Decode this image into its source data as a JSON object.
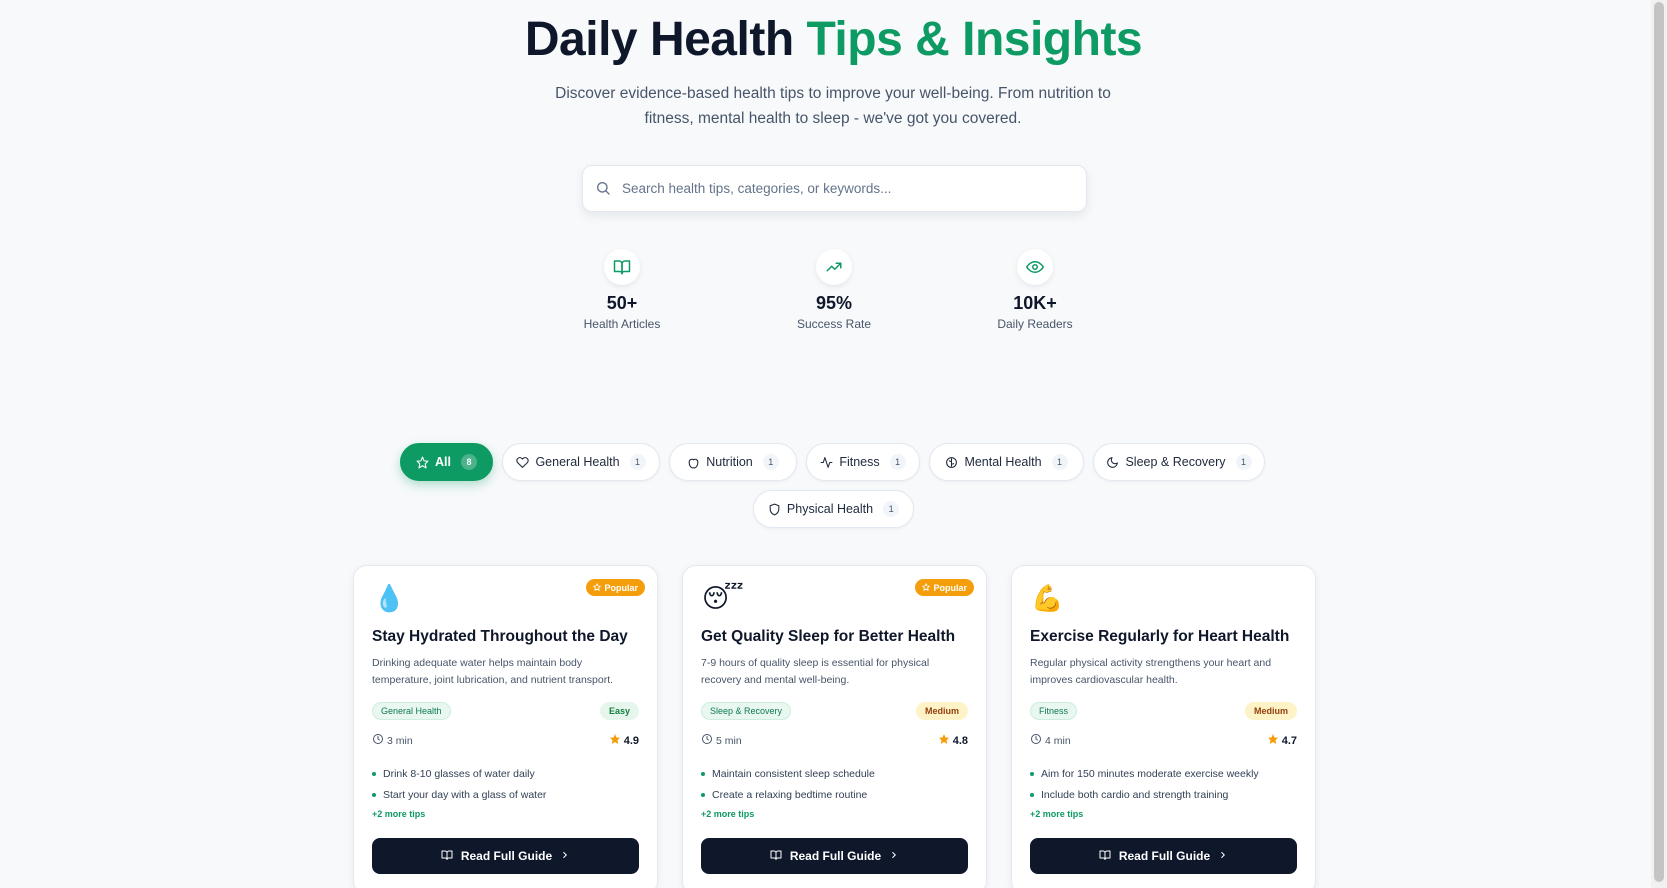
{
  "hero": {
    "title_main": "Daily Health ",
    "title_accent": "Tips & Insights",
    "subtitle": "Discover evidence-based health tips to improve your well-being. From nutrition to fitness, mental health to sleep - we've got you covered."
  },
  "search": {
    "placeholder": "Search health tips, categories, or keywords...",
    "value": ""
  },
  "stats": [
    {
      "icon": "book-open-icon",
      "value": "50+",
      "label": "Health Articles"
    },
    {
      "icon": "trending-up-icon",
      "value": "95%",
      "label": "Success Rate"
    },
    {
      "icon": "eye-icon",
      "value": "10K+",
      "label": "Daily Readers"
    }
  ],
  "filters": [
    {
      "label": "All",
      "count": "8",
      "icon": "star-icon",
      "active": true
    },
    {
      "label": "General Health",
      "count": "1",
      "icon": "heart-icon"
    },
    {
      "label": "Nutrition",
      "count": "1",
      "icon": "apple-icon"
    },
    {
      "label": "Fitness",
      "count": "1",
      "icon": "activity-icon"
    },
    {
      "label": "Mental Health",
      "count": "1",
      "icon": "brain-icon"
    },
    {
      "label": "Sleep & Recovery",
      "count": "1",
      "icon": "moon-icon"
    },
    {
      "label": "Physical Health",
      "count": "1",
      "icon": "shield-icon"
    }
  ],
  "cards": [
    {
      "emoji": "💧",
      "badge": "Popular",
      "title": "Stay Hydrated Throughout the Day",
      "description": "Drinking adequate water helps maintain body temperature, joint lubrication, and nutrient transport.",
      "category": "General Health",
      "difficulty": "Easy",
      "time": "3 min",
      "rating": "4.9",
      "tips": [
        "Drink 8-10 glasses of water daily",
        "Start your day with a glass of water"
      ],
      "more": "+2 more tips",
      "cta": "Read Full Guide"
    },
    {
      "emoji": "😴",
      "badge": "Popular",
      "title": "Get Quality Sleep for Better Health",
      "description": "7-9 hours of quality sleep is essential for physical recovery and mental well-being.",
      "category": "Sleep & Recovery",
      "difficulty": "Medium",
      "time": "5 min",
      "rating": "4.8",
      "tips": [
        "Maintain consistent sleep schedule",
        "Create a relaxing bedtime routine"
      ],
      "more": "+2 more tips",
      "cta": "Read Full Guide"
    },
    {
      "emoji": "💪",
      "badge": "",
      "title": "Exercise Regularly for Heart Health",
      "description": "Regular physical activity strengthens your heart and improves cardiovascular health.",
      "category": "Fitness",
      "difficulty": "Medium",
      "time": "4 min",
      "rating": "4.7",
      "tips": [
        "Aim for 150 minutes moderate exercise weekly",
        "Include both cardio and strength training"
      ],
      "more": "+2 more tips",
      "cta": "Read Full Guide"
    }
  ],
  "colors": {
    "accent": "#0e9a63",
    "dark": "#0f172a",
    "popular": "#f59e0b"
  }
}
